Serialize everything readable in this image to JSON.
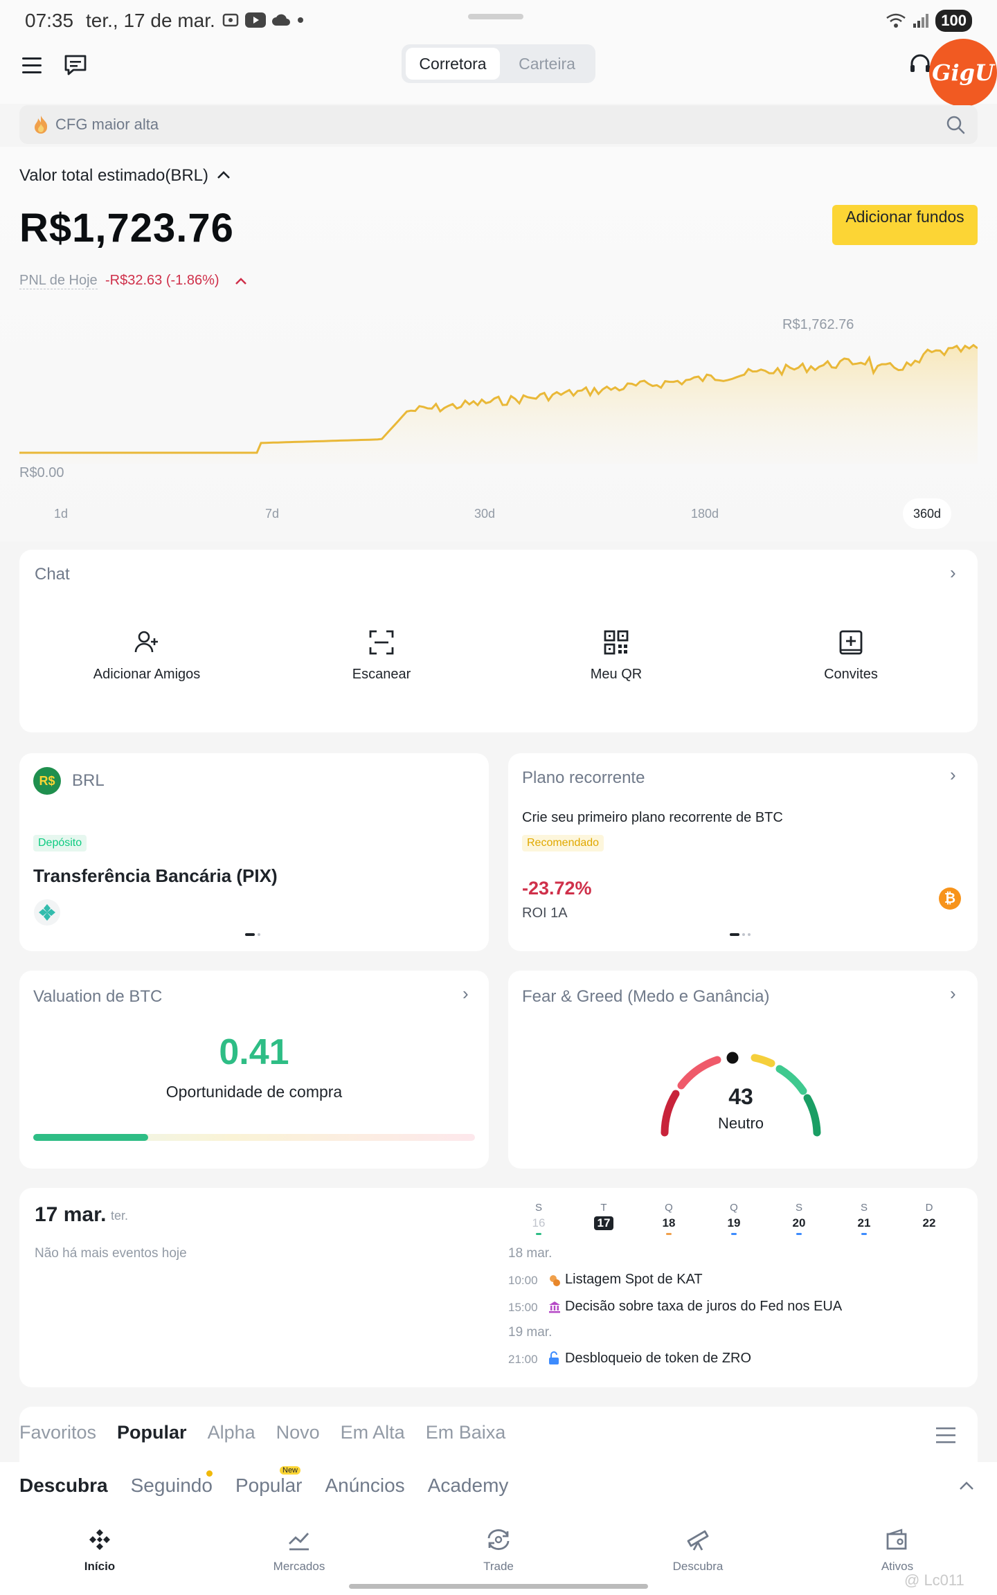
{
  "status": {
    "time": "07:35",
    "date": "ter., 17 de mar.",
    "battery": "100"
  },
  "topnav": {
    "tab_broker": "Corretora",
    "tab_wallet": "Carteira",
    "logo_text": "GigU"
  },
  "search": {
    "placeholder": "CFG maior alta"
  },
  "portfolio": {
    "total_label": "Valor total estimado(BRL)",
    "total_value": "R$1,723.76",
    "add_funds": "Adicionar fundos",
    "pnl_label": "PNL de Hoje",
    "pnl_value": "-R$32.63 (-1.86%)",
    "chart_high": "R$1,762.76",
    "chart_low": "R$0.00",
    "periods": [
      "1d",
      "7d",
      "30d",
      "180d",
      "360d"
    ],
    "active_period": "360d"
  },
  "quick": {
    "title": "Chat",
    "actions": [
      "Adicionar Amigos",
      "Escanear",
      "Meu QR",
      "Convites"
    ]
  },
  "brl_card": {
    "currency_badge": "R$",
    "currency": "BRL",
    "tag": "Depósito",
    "title": "Transferência Bancária (PIX)"
  },
  "recurring_card": {
    "title": "Plano recorrente",
    "desc": "Crie seu primeiro plano recorrente de BTC",
    "tag": "Recomendado",
    "roi_value": "-23.72%",
    "roi_label": "ROI 1A",
    "coin_symbol": "₿"
  },
  "valuation_card": {
    "title": "Valuation de BTC",
    "value": "0.41",
    "label": "Oportunidade de compra",
    "level_fraction": 0.26
  },
  "fear_greed_card": {
    "title": "Fear & Greed (Medo e Ganância)",
    "value": "43",
    "label": "Neutro"
  },
  "calendar": {
    "date": "17 mar.",
    "weekday": "ter.",
    "no_events": "Não há mais eventos hoje",
    "days": [
      {
        "l": "S",
        "n": "16"
      },
      {
        "l": "T",
        "n": "17"
      },
      {
        "l": "Q",
        "n": "18"
      },
      {
        "l": "Q",
        "n": "19"
      },
      {
        "l": "S",
        "n": "20"
      },
      {
        "l": "S",
        "n": "21"
      },
      {
        "l": "D",
        "n": "22"
      }
    ],
    "group1_date": "18 mar.",
    "event1_time": "10:00",
    "event1_text": "Listagem Spot de KAT",
    "event2_time": "15:00",
    "event2_text": "Decisão sobre taxa de juros do Fed nos EUA",
    "group2_date": "19 mar.",
    "event3_time": "21:00",
    "event3_text": "Desbloqueio de token de ZRO"
  },
  "market_tabs": [
    "Favoritos",
    "Popular",
    "Alpha",
    "Novo",
    "Em Alta",
    "Em Baixa"
  ],
  "feed_tabs": [
    "Descubra",
    "Seguindo",
    "Popular",
    "Anúncios",
    "Academy"
  ],
  "feed_new_badge": "New",
  "bottom_nav": [
    "Início",
    "Mercados",
    "Trade",
    "Descubra",
    "Ativos"
  ],
  "watermark": "@ Lc011",
  "colors": {
    "brand_yellow": "#fcd535",
    "up": "#0ecb81",
    "down": "#cf304a",
    "orange": "#f15a22"
  }
}
